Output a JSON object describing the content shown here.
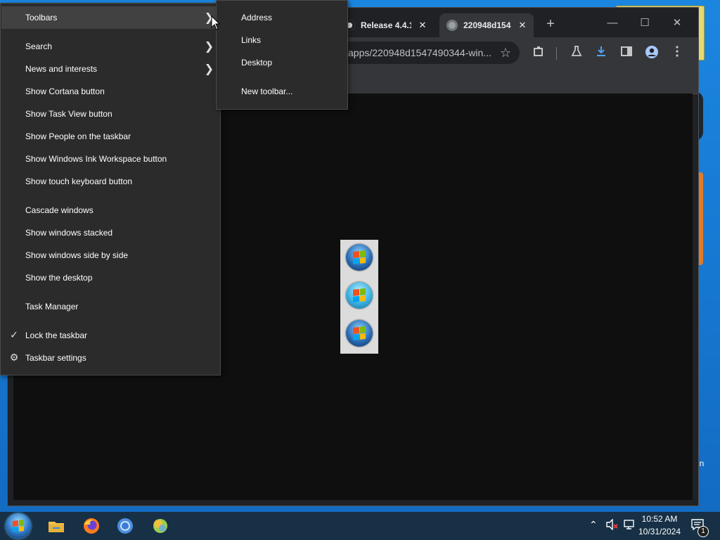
{
  "context_menu": {
    "items": [
      {
        "label": "Toolbars",
        "submenu": true
      },
      {
        "label": "Search",
        "submenu": true
      },
      {
        "label": "News and interests",
        "submenu": true
      },
      {
        "label": "Show Cortana button"
      },
      {
        "label": "Show Task View button"
      },
      {
        "label": "Show People on the taskbar"
      },
      {
        "label": "Show Windows Ink Workspace button"
      },
      {
        "label": "Show touch keyboard button"
      },
      {
        "label": "Cascade windows"
      },
      {
        "label": "Show windows stacked"
      },
      {
        "label": "Show windows side by side"
      },
      {
        "label": "Show the desktop"
      },
      {
        "label": "Task Manager"
      },
      {
        "label": "Lock the taskbar",
        "checked": true
      },
      {
        "label": "Taskbar settings",
        "icon": "gear-icon"
      }
    ]
  },
  "toolbars_submenu": {
    "items": [
      {
        "label": "Address"
      },
      {
        "label": "Links"
      },
      {
        "label": "Desktop"
      },
      {
        "label": "New toolbar..."
      }
    ]
  },
  "browser": {
    "tabs": [
      {
        "title": "Release 4.4.1",
        "icon": "github-icon"
      },
      {
        "title": "220948d154",
        "icon": "globe-icon",
        "active": true
      }
    ],
    "close_glyph": "✕",
    "new_tab_glyph": "+",
    "window_controls": {
      "minimize": "—",
      "maximize": "☐",
      "close": "✕"
    },
    "address_text": "apps/220948d1547490344-win...",
    "star_glyph": "☆"
  },
  "taskbar": {
    "clock_time": "10:52 AM",
    "clock_date": "10/31/2024",
    "notification_count": "1",
    "apps": [
      "file-explorer-icon",
      "firefox-icon",
      "chrome-icon",
      "app-orb-icon"
    ]
  },
  "desktop": {
    "edge_text": "in"
  },
  "colors": {
    "menu_bg": "#2b2b2b",
    "menu_highlight": "#414141",
    "taskbar_bg": "#173046",
    "desktop_bg": "#1676cf"
  }
}
